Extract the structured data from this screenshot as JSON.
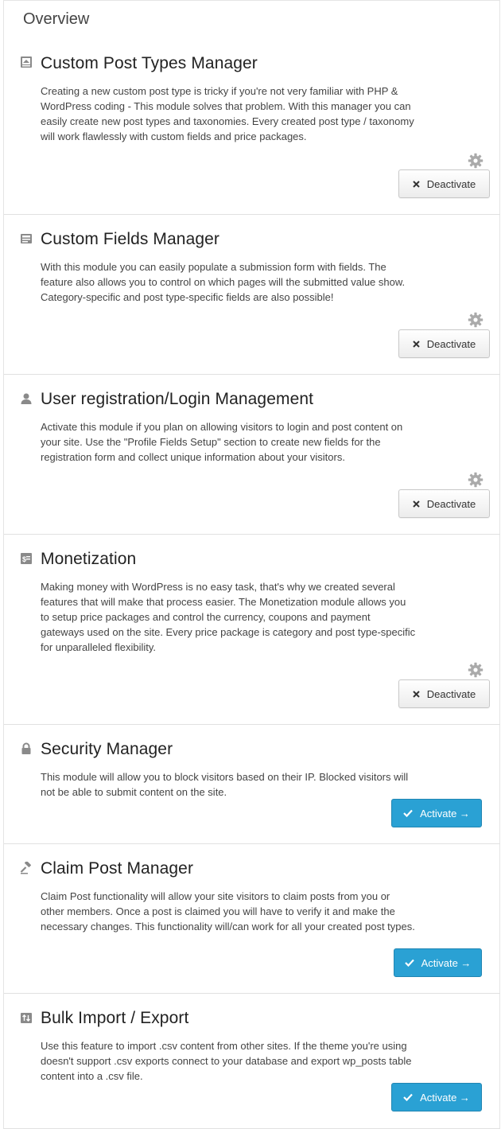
{
  "page": {
    "title": "Overview"
  },
  "modules": [
    {
      "title": "Custom Post Types Manager",
      "description": "Creating a new custom post type is tricky if you're not very familiar with PHP & WordPress coding - This module solves that problem. With this manager you can easily create new post types and taxonomies. Every created post type / taxonomy will work flawlessly with custom fields and price packages.",
      "icon": "post-types-icon",
      "status": "active",
      "button_label": "Deactivate",
      "button_icon": "close-icon",
      "has_settings": true
    },
    {
      "title": "Custom Fields Manager",
      "description": "With this module you can easily populate a submission form with fields. The feature also allows you to control on which pages will the submitted value show. Category-specific and post type-specific fields are also possible!",
      "icon": "custom-fields-icon",
      "status": "active",
      "button_label": "Deactivate",
      "button_icon": "close-icon",
      "has_settings": true
    },
    {
      "title": "User registration/Login Management",
      "description": "Activate this module if you plan on allowing visitors to login and post content on your site. Use the \"Profile Fields Setup\" section to create new fields for the registration form and collect unique information about your visitors.",
      "icon": "user-icon",
      "status": "active",
      "button_label": "Deactivate",
      "button_icon": "close-icon",
      "has_settings": true
    },
    {
      "title": "Monetization",
      "description": "Making money with WordPress is no easy task, that's why we created several features that will make that process easier. The Monetization module allows you to setup price packages and control the currency, coupons and payment gateways used on the site. Every price package is category and post type-specific for unparalleled flexibility.",
      "icon": "money-icon",
      "status": "active",
      "button_label": "Deactivate",
      "button_icon": "close-icon",
      "has_settings": true
    },
    {
      "title": "Security Manager",
      "description": "This module will allow you to block visitors based on their IP. Blocked visitors will not be able to submit content on the site.",
      "icon": "lock-icon",
      "status": "inactive",
      "button_label": "Activate →",
      "button_icon": "check-icon",
      "has_settings": false
    },
    {
      "title": "Claim Post Manager",
      "description": "Claim Post functionality will allow your site visitors to claim posts from you or other members. Once a post is claimed you will have to verify it and make the necessary changes. This functionality will/can work for all your created post types.",
      "icon": "gavel-icon",
      "status": "inactive",
      "button_label": "Activate →",
      "button_icon": "check-icon",
      "has_settings": false
    },
    {
      "title": "Bulk Import / Export",
      "description": "Use this feature to import .csv content from other sites. If the theme you're using doesn't support .csv exports connect to your database and export wp_posts table content into a .csv file.",
      "icon": "import-export-icon",
      "status": "inactive",
      "button_label": "Activate →",
      "button_icon": "check-icon",
      "has_settings": false
    }
  ],
  "colors": {
    "activate_bg": "#2aa1d4",
    "deactivate_bg": "#f5f5f5",
    "gear": "#aaaaaa",
    "icon": "#8a8a8a"
  }
}
